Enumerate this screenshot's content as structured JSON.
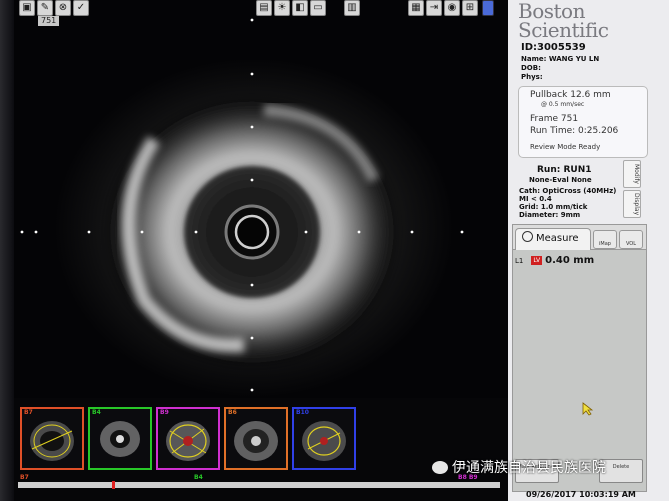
{
  "toolbar": {
    "left_icons": [
      "window-icon",
      "pen-icon",
      "target-icon",
      "check-icon"
    ],
    "center_icons": [
      "image-icon",
      "bulb-icon",
      "layers-icon",
      "monitor-icon",
      "ruler-icon"
    ],
    "right_icons": [
      "film-icon",
      "export-icon",
      "camera-icon",
      "network-icon",
      "battery-icon"
    ]
  },
  "image": {
    "frame_tag": "751"
  },
  "brand": {
    "line1": "Boston",
    "line2": "Scientific"
  },
  "patient": {
    "id": "ID:3005539",
    "name": "Name: WANG YU LN",
    "dob": "DOB:",
    "phys": "Phys:"
  },
  "pullback": {
    "title": "Pullback 12.6 mm",
    "speed": "@ 0.5 mm/sec",
    "frame": "Frame 751",
    "run_time": "Run Time: 0:25.206",
    "mode": "Review Mode Ready"
  },
  "run": {
    "title": "Run: RUN1",
    "eval": "None-Eval None",
    "cath": "Cath: OptiCross (40MHz)",
    "mi": "MI  <  0.4",
    "grid": "Grid:   1.0 mm/tick",
    "diameter": "Diameter:   9mm"
  },
  "side_tabs": [
    "Modify",
    "Display"
  ],
  "measure": {
    "tab_label": "Measure",
    "small_tabs": [
      "iMap",
      "VOL"
    ],
    "l1_label": "L1",
    "lv_badge": "LV",
    "l1_value": "0.40 mm",
    "btn_left": "Mark Reference",
    "btn_right": "Delete"
  },
  "thumbnails": [
    {
      "label": "B7",
      "color": "#e05028"
    },
    {
      "label": "B4",
      "color": "#28c828"
    },
    {
      "label": "B9",
      "color": "#d030d0"
    },
    {
      "label": "B6",
      "color": "#e07028"
    },
    {
      "label": "B10",
      "color": "#3040e8"
    }
  ],
  "timeline": {
    "left_tag": "B7",
    "mid_tag": "B4",
    "right_tag": "B8 B9"
  },
  "status": {
    "datetime": "09/26/2017 10:03:19 AM"
  },
  "watermark": {
    "text": "伊通满族自治县民族医院"
  },
  "colors": {
    "panel_bg": "#ececef",
    "lv_red": "#d02020",
    "ultrasound_bg": "#040406"
  }
}
